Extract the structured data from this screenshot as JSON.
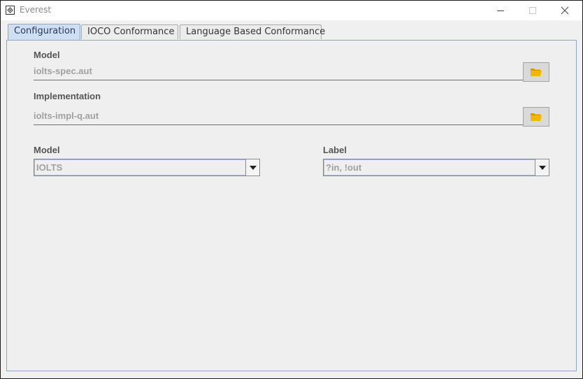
{
  "window": {
    "title": "Everest"
  },
  "tabs": [
    {
      "label": "Configuration",
      "active": true
    },
    {
      "label": "IOCO Conformance",
      "active": false
    },
    {
      "label": "Language Based Conformance",
      "active": false
    }
  ],
  "config": {
    "model_file": {
      "label": "Model",
      "value": "iolts-spec.aut",
      "icon": "folder-open-icon"
    },
    "implementation_file": {
      "label": "Implementation",
      "value": "iolts-impl-q.aut",
      "icon": "folder-open-icon"
    },
    "model_type": {
      "label": "Model",
      "selected": "IOLTS"
    },
    "label_type": {
      "label": "Label",
      "selected": "?in, !out"
    }
  },
  "colors": {
    "folder_icon": "#f2b705",
    "active_tab": "#cfdff1",
    "panel_border": "#8fa7c4"
  }
}
